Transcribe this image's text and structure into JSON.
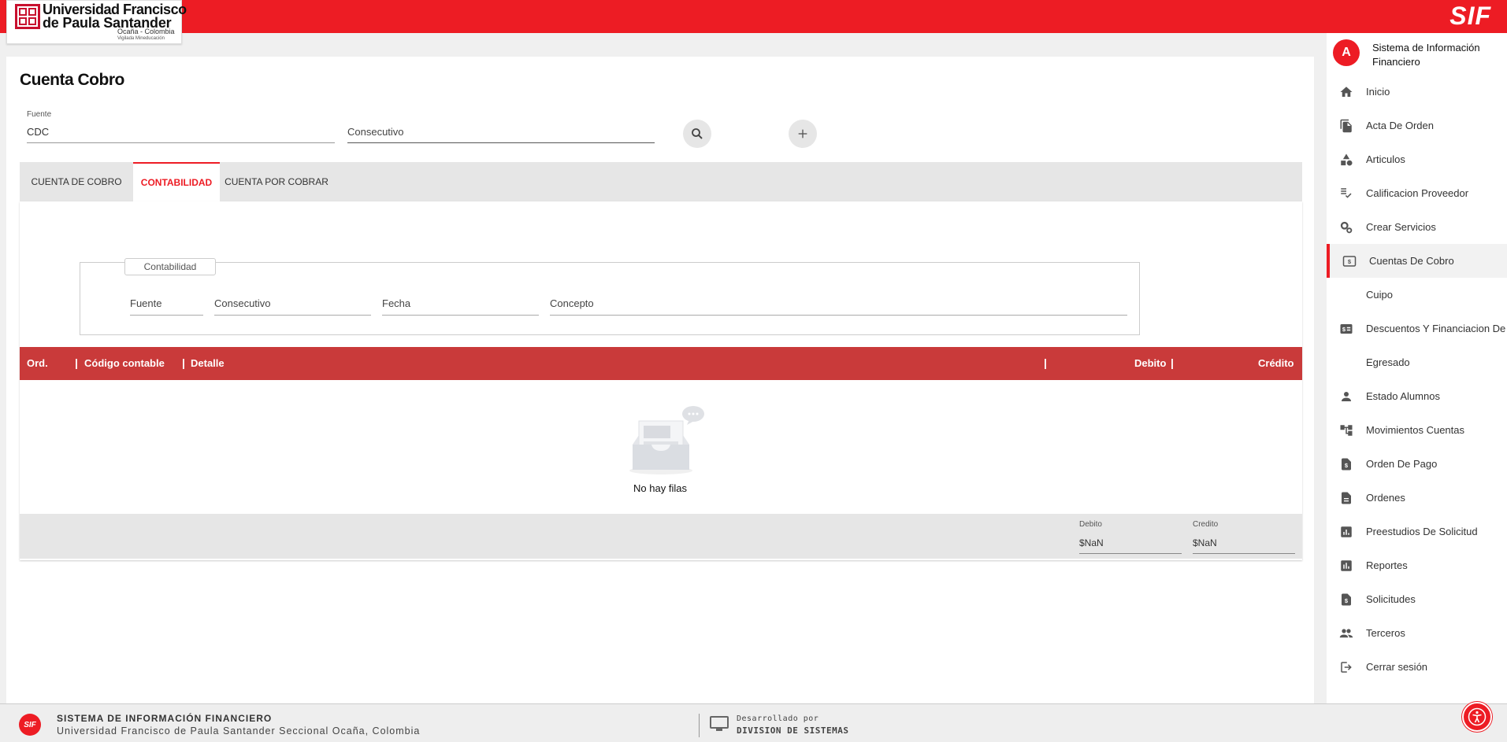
{
  "header": {
    "logo_line1": "Universidad Francisco",
    "logo_line2": "de Paula Santander",
    "logo_line3": "Ocaña - Colombia",
    "logo_line4": "Vigilada Mineducación",
    "brand": "SIF",
    "brand_color": "#ed1c24"
  },
  "page": {
    "title": "Cuenta Cobro",
    "fuente_label": "Fuente",
    "fuente_value": "CDC",
    "consecutivo_placeholder": "Consecutivo",
    "search_icon": "search-icon",
    "add_icon": "add-icon"
  },
  "tabs": [
    {
      "label": "CUENTA DE COBRO",
      "active": false
    },
    {
      "label": "CONTABILIDAD",
      "active": true
    },
    {
      "label": "CUENTA POR COBRAR",
      "active": false
    }
  ],
  "contabilidad": {
    "legend": "Contabilidad",
    "fields": [
      "Fuente",
      "Consecutivo",
      "Fecha",
      "Concepto"
    ]
  },
  "table": {
    "columns": [
      "Ord.",
      "Código contable",
      "Detalle",
      "Debito",
      "Crédito"
    ],
    "header_color": "#c93a3a",
    "empty_text": "No hay filas",
    "totals": {
      "debito_label": "Debito",
      "debito_value": "$NaN",
      "credito_label": "Credito",
      "credito_value": "$NaN"
    }
  },
  "sidebar": {
    "avatar": "A",
    "title": "Sistema de Información Financiero",
    "items": [
      {
        "label": "Inicio",
        "icon": "home-icon"
      },
      {
        "label": "Acta De Orden",
        "icon": "file-copy-icon"
      },
      {
        "label": "Articulos",
        "icon": "category-icon"
      },
      {
        "label": "Calificacion Proveedor",
        "icon": "grading-icon"
      },
      {
        "label": "Crear Servicios",
        "icon": "settings-icon"
      },
      {
        "label": "Cuentas De Cobro",
        "icon": "dollar-card-icon",
        "active": true
      },
      {
        "label": "Cuipo",
        "icon": ""
      },
      {
        "label": "Descuentos Y Financiacion De",
        "icon": "money-icon"
      },
      {
        "label": "Egresado",
        "icon": ""
      },
      {
        "label": "Estado Alumnos",
        "icon": "person-icon"
      },
      {
        "label": "Movimientos Cuentas",
        "icon": "account-tree-icon"
      },
      {
        "label": "Orden De Pago",
        "icon": "request-quote-icon"
      },
      {
        "label": "Ordenes",
        "icon": "description-icon"
      },
      {
        "label": "Preestudios De Solicitud",
        "icon": "analytics-icon"
      },
      {
        "label": "Reportes",
        "icon": "bar-chart-icon"
      },
      {
        "label": "Solicitudes",
        "icon": "request-page-icon"
      },
      {
        "label": "Terceros",
        "icon": "people-icon"
      },
      {
        "label": "Cerrar sesión",
        "icon": "logout-icon"
      }
    ]
  },
  "footer": {
    "logo": "SIF",
    "title": "SISTEMA DE INFORMACIÓN FINANCIERO",
    "subtitle": "Universidad Francisco de Paula Santander Seccional Ocaña, Colombia",
    "dev_line1": "Desarrollado por",
    "dev_line2": "DIVISION DE SISTEMAS"
  }
}
